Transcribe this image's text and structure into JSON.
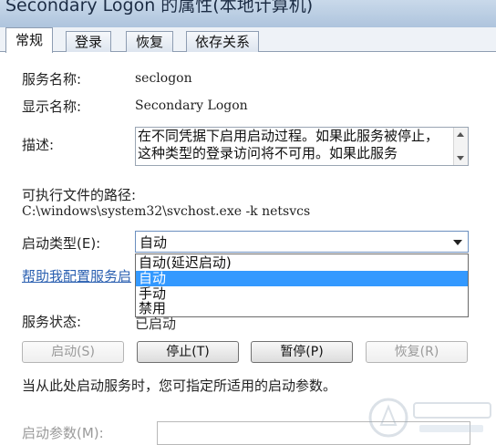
{
  "window": {
    "title": "Secondary Logon 的属性(本地计算机)"
  },
  "tabs": [
    {
      "label": "常规",
      "active": true
    },
    {
      "label": "登录",
      "active": false
    },
    {
      "label": "恢复",
      "active": false
    },
    {
      "label": "依存关系",
      "active": false
    }
  ],
  "general": {
    "service_name_label": "服务名称:",
    "service_name_value": "seclogon",
    "display_name_label": "显示名称:",
    "display_name_value": "Secondary Logon",
    "description_label": "描述:",
    "description_value": "在不同凭据下启用启动过程。如果此服务被停止，这种类型的登录访问将不可用。如果此服务",
    "exe_path_label": "可执行文件的路径:",
    "exe_path_value": "C:\\windows\\system32\\svchost.exe -k netsvcs",
    "startup_type_label": "启动类型(E):",
    "startup_type_value": "自动",
    "startup_options": [
      "自动(延迟启动)",
      "自动",
      "手动",
      "禁用"
    ],
    "startup_selected_index": 1,
    "help_link": "帮助我配置服务启",
    "status_label": "服务状态:",
    "status_value": "已启动",
    "buttons": {
      "start": "启动(S)",
      "stop": "停止(T)",
      "pause": "暂停(P)",
      "resume": "恢复(R)"
    },
    "params_hint": "当从此处启动服务时，您可指定所适用的启动参数。",
    "params_label": "启动参数(M):"
  },
  "colors": {
    "selection": "#3399ff",
    "link": "#2a5fb0"
  }
}
